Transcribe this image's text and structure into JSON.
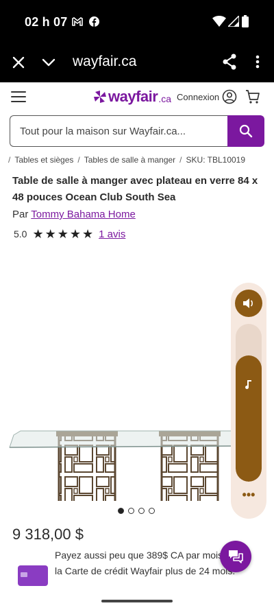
{
  "status_bar": {
    "time": "02 h 07",
    "left_icons": [
      "gmail-icon",
      "facebook-icon"
    ],
    "right_icons": [
      "wifi-icon",
      "signal-icon",
      "battery-icon"
    ]
  },
  "browser": {
    "domain": "wayfair.ca",
    "icons": [
      "close-icon",
      "chevron-down-icon",
      "share-icon",
      "more-vert-icon"
    ]
  },
  "header": {
    "logo_text": "wayfair",
    "logo_tld": ".ca",
    "signin_label": "Connexion",
    "brand_color": "#7b189f"
  },
  "search": {
    "placeholder": "Tout pour la maison sur Wayfair.ca..."
  },
  "breadcrumb": {
    "items": [
      "Tables et sièges",
      "Tables de salle à manger"
    ],
    "sku": "SKU: TBL10019"
  },
  "product": {
    "title": "Table de salle à manger avec plateau en verre 84 x 48 pouces Ocean Club South Sea",
    "by_prefix": "Par",
    "brand": "Tommy Bahama Home",
    "rating": "5.0",
    "stars": 5,
    "reviews_label": "1 avis",
    "image_count": 4,
    "active_image": 1,
    "price": "9 318,00 $",
    "financing": "Payez aussi peu que 389$ CA par mois avec la Carte de crédit Wayfair plus de 24 mois."
  },
  "overlay": {
    "accent_color": "#8c5a14",
    "volume_level": 0.8
  }
}
